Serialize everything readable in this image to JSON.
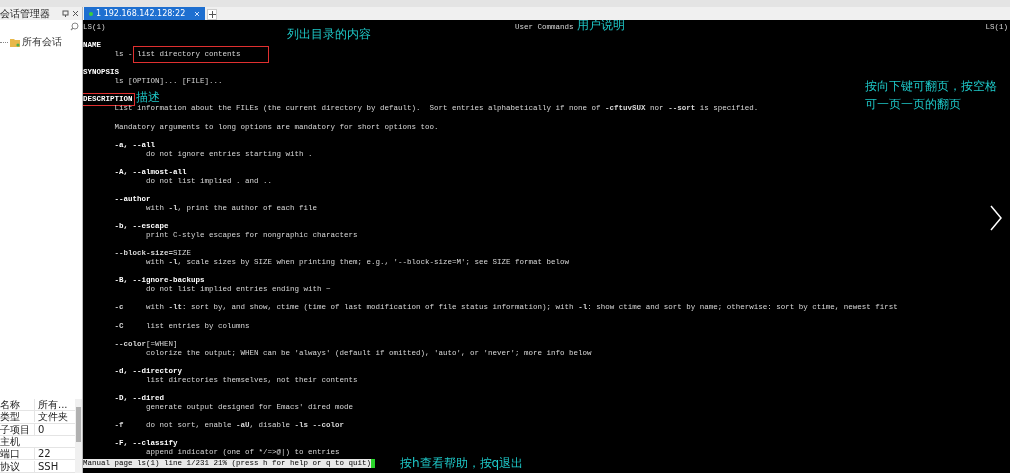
{
  "session_manager": {
    "title": "会话管理器",
    "tree": [
      {
        "label": "所有会话",
        "expanded": false
      }
    ],
    "properties": [
      {
        "name": "名称",
        "value": "所有..."
      },
      {
        "name": "类型",
        "value": "文件夹"
      },
      {
        "name": "子项目",
        "value": "0"
      },
      {
        "name": "主机"
      },
      {
        "name": "端口",
        "value": "22"
      },
      {
        "name": "协议",
        "value": "SSH"
      }
    ]
  },
  "tabs": [
    {
      "label": "1 192.168.142.128:22",
      "selected": true,
      "connected": true
    }
  ],
  "terminal": {
    "header": {
      "left": "LS(1)",
      "center": "User Commands",
      "right": "LS(1)",
      "note": "用户说明"
    },
    "blocks": [
      {
        "lines": [
          {
            "kind": "heading",
            "text": "NAME"
          },
          {
            "kind": "indent1",
            "text": "ls - ",
            "boxed_part": "list directory contents"
          }
        ]
      },
      {
        "lines": [
          {
            "kind": "heading",
            "text": "SYNOPSIS"
          },
          {
            "kind": "indent1",
            "text": "ls [OPTION]... [FILE]..."
          }
        ]
      },
      {
        "lines": [
          {
            "kind": "heading",
            "text": "DESCRIPTION",
            "boxed": true,
            "note": "描述"
          },
          {
            "kind": "indent1",
            "text": "List information about the FILEs (the current directory by default).  Sort entries alphabetically if none of **-cftuvSUX** nor **--sort** is specified."
          }
        ]
      },
      {
        "lines": [
          {
            "kind": "indent1",
            "text": "Mandatory arguments to long options are mandatory for short options too."
          }
        ]
      },
      {
        "lines": [
          {
            "kind": "option",
            "text": "-a, --all"
          },
          {
            "kind": "indent2",
            "text": "do not ignore entries starting with ."
          }
        ]
      },
      {
        "lines": [
          {
            "kind": "option",
            "text": "-A, --almost-all"
          },
          {
            "kind": "indent2",
            "text": "do not list implied . and .."
          }
        ]
      },
      {
        "lines": [
          {
            "kind": "option",
            "text": "--author"
          },
          {
            "kind": "indent2",
            "text": "with **-l**, print the author of each file"
          }
        ]
      },
      {
        "lines": [
          {
            "kind": "option",
            "text": "-b, --escape"
          },
          {
            "kind": "indent2",
            "text": "print C-style escapes for nongraphic characters"
          }
        ]
      },
      {
        "lines": [
          {
            "kind": "indent1",
            "text": "**--block-size=**SIZE"
          },
          {
            "kind": "indent2",
            "text": "with **-l**, scale sizes by SIZE when printing them; e.g., '--block-size=M'; see SIZE format below"
          }
        ]
      },
      {
        "lines": [
          {
            "kind": "option",
            "text": "-B, --ignore-backups"
          },
          {
            "kind": "indent2",
            "text": "do not list implied entries ending with ~"
          }
        ]
      },
      {
        "lines": [
          {
            "kind": "indent1",
            "text": "**-c**     with **-lt**: sort by, and show, ctime (time of last modification of file status information); with **-l**: show ctime and sort by name; otherwise: sort by ctime, newest first"
          }
        ]
      },
      {
        "lines": [
          {
            "kind": "indent1",
            "text": "**-C**     list entries by columns"
          }
        ]
      },
      {
        "lines": [
          {
            "kind": "indent1",
            "text": "**--color**[=WHEN]"
          },
          {
            "kind": "indent2",
            "text": "colorize the output; WHEN can be 'always' (default if omitted), 'auto', or 'never'; more info below"
          }
        ]
      },
      {
        "lines": [
          {
            "kind": "option",
            "text": "-d, --directory"
          },
          {
            "kind": "indent2",
            "text": "list directories themselves, not their contents"
          }
        ]
      },
      {
        "lines": [
          {
            "kind": "option",
            "text": "-D, --dired"
          },
          {
            "kind": "indent2",
            "text": "generate output designed for Emacs' dired mode"
          }
        ]
      },
      {
        "lines": [
          {
            "kind": "indent1",
            "text": "**-f**     do not sort, enable **-aU**, disable **-ls --color**"
          }
        ]
      },
      {
        "lines": [
          {
            "kind": "option",
            "text": "-F, --classify"
          },
          {
            "kind": "indent2",
            "text": "append indicator (one of */=>@|) to entries"
          }
        ]
      }
    ],
    "status_line": "Manual page ls(1) line 1/231 21% (press h for help or q to quit)"
  },
  "annotations": [
    {
      "text": "列出目录的内容"
    },
    {
      "text": "按向下键可翻页，按空格"
    },
    {
      "text": "可一页一页的翻页"
    },
    {
      "text": "按h查看帮助，按q退出"
    }
  ]
}
